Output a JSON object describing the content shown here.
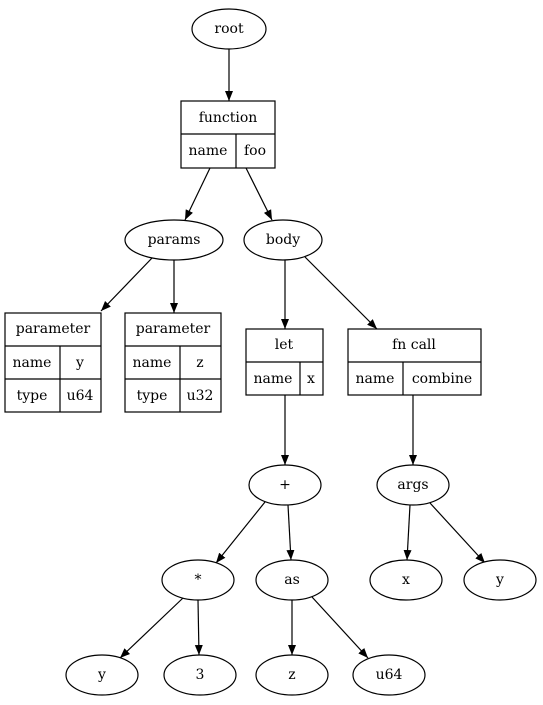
{
  "nodes": {
    "root": "root",
    "function": {
      "title": "function",
      "name_key": "name",
      "name_val": "foo"
    },
    "params": "params",
    "body": "body",
    "param1": {
      "title": "parameter",
      "name_key": "name",
      "name_val": "y",
      "type_key": "type",
      "type_val": "u64"
    },
    "param2": {
      "title": "parameter",
      "name_key": "name",
      "name_val": "z",
      "type_key": "type",
      "type_val": "u32"
    },
    "let": {
      "title": "let",
      "name_key": "name",
      "name_val": "x"
    },
    "fncall": {
      "title": "fn call",
      "name_key": "name",
      "name_val": "combine"
    },
    "plus": "+",
    "args": "args",
    "mul": "*",
    "as": "as",
    "arg_x": "x",
    "arg_y": "y",
    "mul_y": "y",
    "mul_3": "3",
    "as_z": "z",
    "as_u64": "u64"
  }
}
